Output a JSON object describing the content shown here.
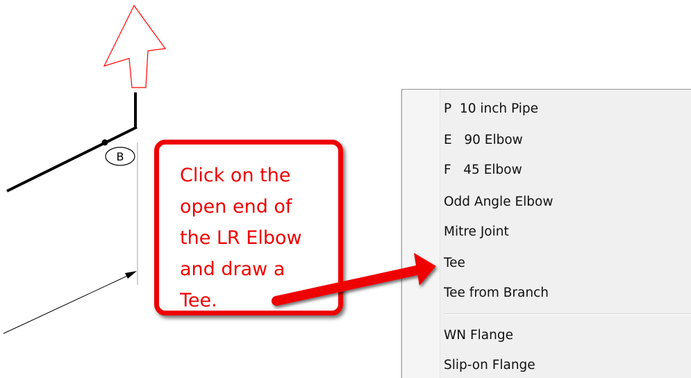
{
  "callout": {
    "text": "Click on the\nopen end of\nthe LR Elbow\nand draw a\nTee."
  },
  "drawing": {
    "node_label": "B"
  },
  "context_menu": {
    "items": [
      {
        "label": "P  10 inch Pipe"
      },
      {
        "label": "E   90 Elbow"
      },
      {
        "label": "F   45 Elbow"
      },
      {
        "label": "Odd Angle Elbow"
      },
      {
        "label": "Mitre Joint"
      },
      {
        "label": "Tee"
      },
      {
        "label": "Tee from Branch"
      },
      {
        "label": "WN Flange"
      },
      {
        "label": "Slip-on Flange"
      }
    ]
  },
  "colors": {
    "callout_red": "#ee0000",
    "north_arrow_red": "#ff0000",
    "pipe_black": "#000000",
    "menu_background": "#f0f0f0"
  },
  "icons": {
    "north_arrow": "north-arrow-icon",
    "pointer_arrow": "red-pointer-arrow-icon"
  }
}
